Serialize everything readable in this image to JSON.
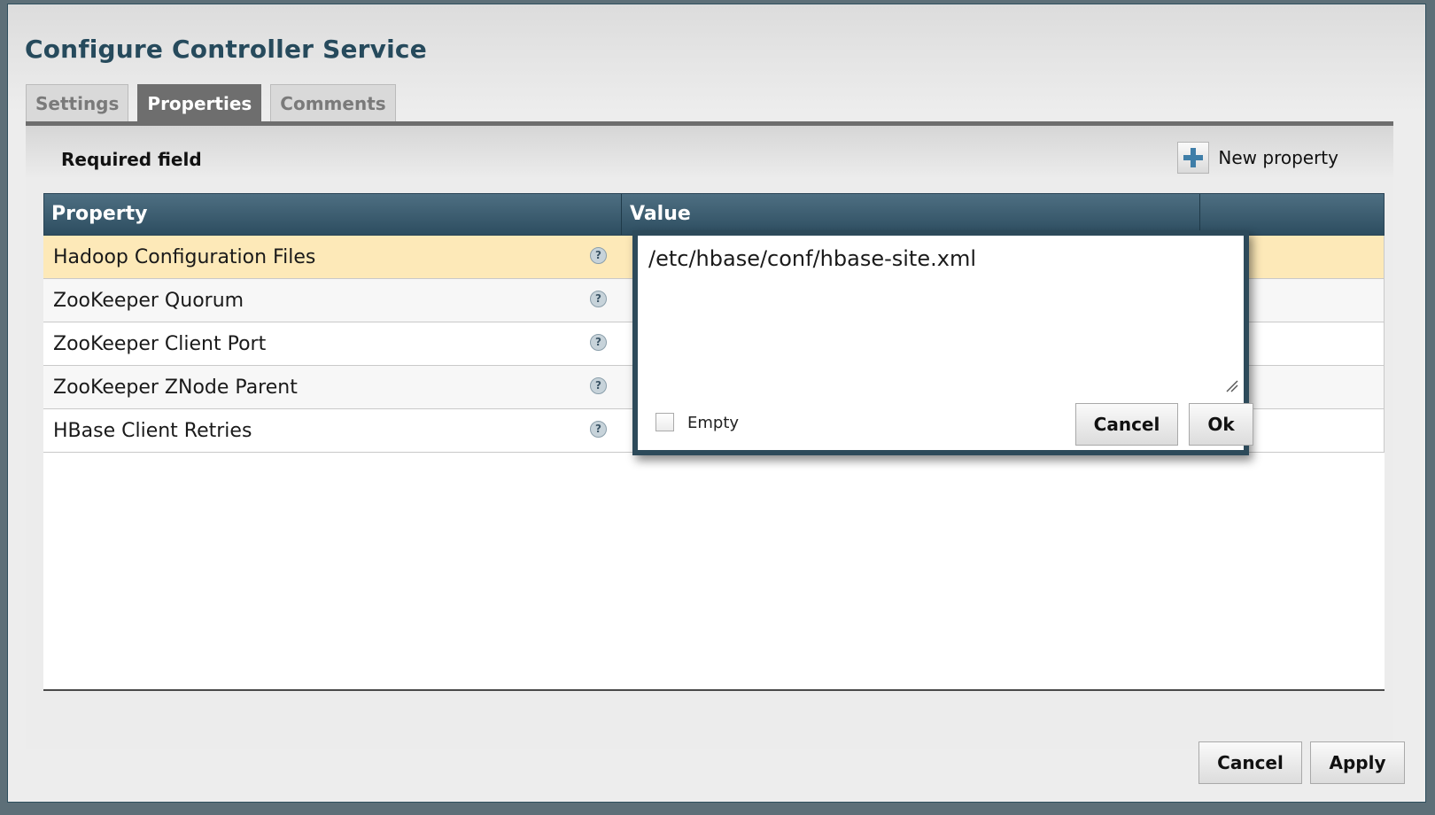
{
  "dialog": {
    "title": "Configure Controller Service"
  },
  "tabs": [
    {
      "label": "Settings"
    },
    {
      "label": "Properties"
    },
    {
      "label": "Comments"
    }
  ],
  "properties_panel": {
    "required_field_label": "Required field",
    "new_property_label": "New property",
    "columns": {
      "property": "Property",
      "value": "Value"
    },
    "rows": [
      {
        "property": "Hadoop Configuration Files"
      },
      {
        "property": "ZooKeeper Quorum"
      },
      {
        "property": "ZooKeeper Client Port"
      },
      {
        "property": "ZooKeeper ZNode Parent"
      },
      {
        "property": "HBase Client Retries"
      }
    ],
    "help_glyph": "?"
  },
  "value_editor": {
    "value": "/etc/hbase/conf/hbase-site.xml",
    "empty_label": "Empty",
    "empty_checked": false,
    "cancel_label": "Cancel",
    "ok_label": "Ok"
  },
  "footer": {
    "cancel_label": "Cancel",
    "apply_label": "Apply"
  },
  "colors": {
    "title": "#264a5c",
    "table_header": "#3d5e71",
    "selected_row": "#fde9b8",
    "active_tab": "#6e6e6e",
    "editor_border": "#2d4a5a"
  },
  "icons": [
    "add-icon",
    "help-icon",
    "resize-grip-icon"
  ]
}
